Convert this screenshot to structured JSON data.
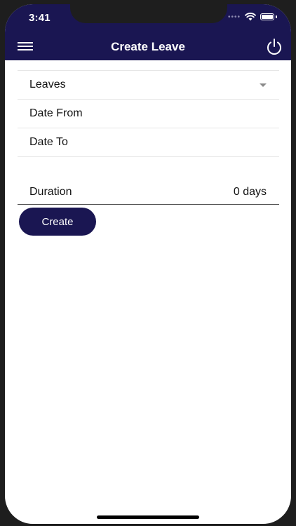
{
  "status_bar": {
    "time": "3:41",
    "signal_dots": "••••"
  },
  "header": {
    "title": "Create Leave",
    "menu_icon": "hamburger-menu-icon",
    "power_icon": "power-icon"
  },
  "form": {
    "leave_type_label": "Leaves",
    "date_from_label": "Date From",
    "date_to_label": "Date To",
    "duration_label": "Duration",
    "duration_value": "0 days"
  },
  "actions": {
    "create_label": "Create"
  },
  "colors": {
    "primary": "#1a1652",
    "background": "#ffffff",
    "frame": "#1e1e1e"
  }
}
